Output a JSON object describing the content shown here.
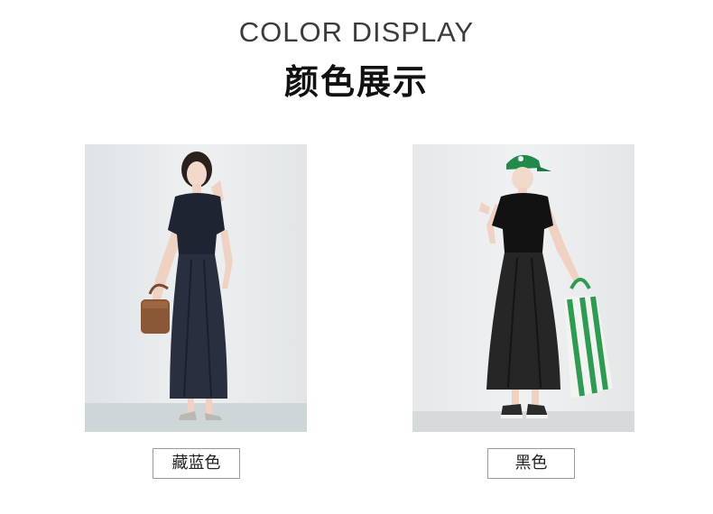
{
  "header": {
    "subtitle": "COLOR DISPLAY",
    "title": "颜色展示"
  },
  "colors": [
    {
      "label": "藏蓝色",
      "swatch": "#252a3a"
    },
    {
      "label": "黑色",
      "swatch": "#1c1c1c"
    }
  ]
}
